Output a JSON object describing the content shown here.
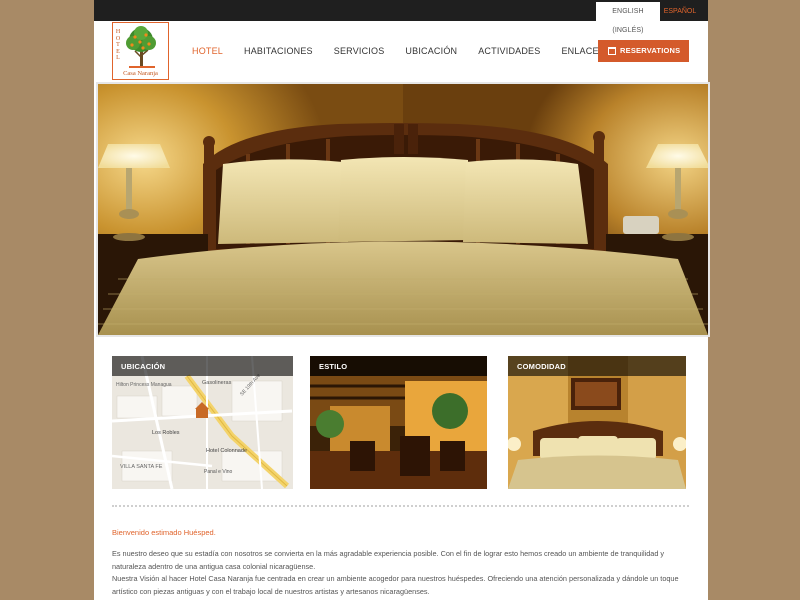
{
  "topbar": {
    "lang_english": "ENGLISH (INGLÉS)",
    "lang_spanish": "ESPAÑOL"
  },
  "logo": {
    "vertical_text": "HOTEL",
    "name": "Casa Naranja"
  },
  "nav": {
    "items": [
      {
        "label": "HOTEL",
        "active": true
      },
      {
        "label": "HABITACIONES",
        "active": false
      },
      {
        "label": "SERVICIOS",
        "active": false
      },
      {
        "label": "UBICACIÓN",
        "active": false
      },
      {
        "label": "ACTIVIDADES",
        "active": false
      },
      {
        "label": "ENLACES",
        "active": false
      }
    ],
    "reservations_label": "RESERVATIONS"
  },
  "thumbs": {
    "map_label": "UBICACIÓN",
    "estilo_label": "ESTILO",
    "comodidad_label": "COMODIDAD"
  },
  "map": {
    "labels": {
      "hilton": "Hilton Princess Managua",
      "gasolineras": "Gasolineras",
      "los_robles": "Los Robles",
      "hotel_colonnade": "Hotel Colonnade",
      "villa_santa_fe": "VILLA SANTA FE",
      "panal": "Panal e Vino",
      "av": "SE 19th Ave"
    }
  },
  "content": {
    "welcome": "Bienvenido estimado Huésped.",
    "paragraph1": "Es nuestro deseo que su estadía con nosotros se convierta en la más agradable experiencia posible. Con el fin de lograr esto hemos creado un ambiente de tranquilidad y naturaleza adentro de una antigua casa colonial nicaragüense.",
    "paragraph2": "Nuestra Visión al hacer Hotel Casa Naranja fue centrada en crear un ambiente acogedor para nuestros huéspedes. Ofreciendo una atención personalizada y dándole un toque artístico con piezas antiguas y con el trabajo local de nuestros artistas y artesanos nicaragüenses."
  },
  "colors": {
    "accent": "#e0642c",
    "background": "#a88a66",
    "topbar": "#1f1f1f"
  }
}
